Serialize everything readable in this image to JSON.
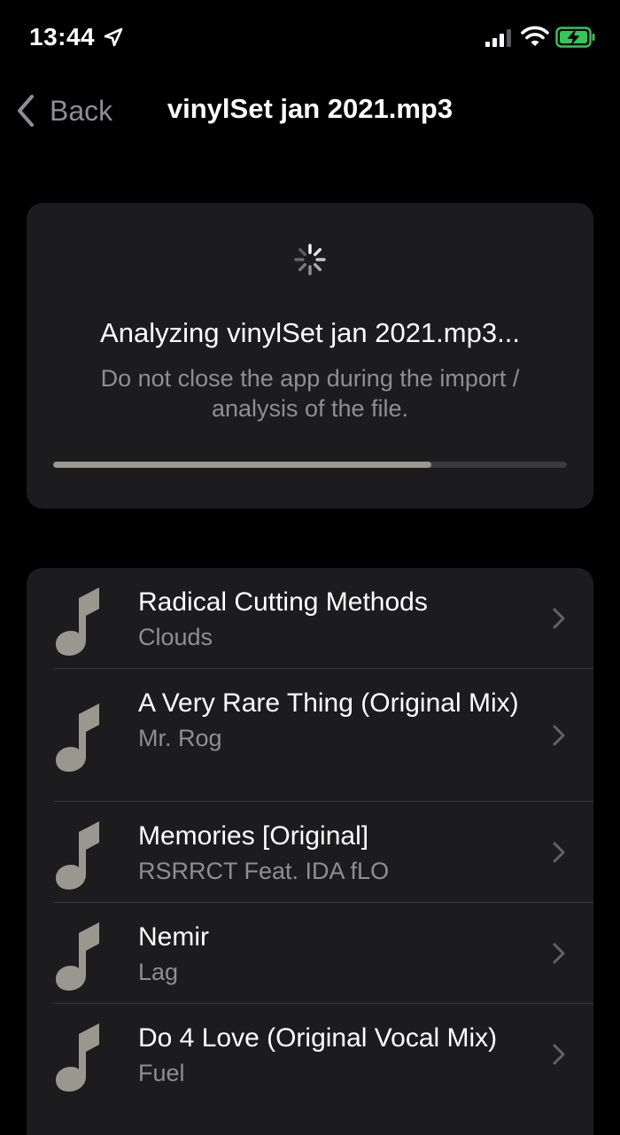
{
  "status_bar": {
    "time": "13:44"
  },
  "nav": {
    "back_label": "Back",
    "title": "vinylSet jan 2021.mp3"
  },
  "progress": {
    "title": "Analyzing vinylSet jan 2021.mp3...",
    "description": "Do not close the app during the import / analysis of the file.",
    "fraction": 0.736
  },
  "tracks": [
    {
      "title": "Radical Cutting Methods",
      "artist": "Clouds"
    },
    {
      "title": "A Very Rare Thing (Original Mix)",
      "artist": "Mr. Rog"
    },
    {
      "title": "Memories [Original]",
      "artist": "RSRRCT Feat. IDA fLO"
    },
    {
      "title": "Nemir",
      "artist": "Lag"
    },
    {
      "title": "Do 4 Love (Original Vocal Mix)",
      "artist": "Fuel"
    }
  ],
  "colors": {
    "background": "#000000",
    "card": "#1c1c1e",
    "secondary_text": "#8e8e93",
    "note_icon": "#98988f",
    "battery_green": "#34c759"
  }
}
